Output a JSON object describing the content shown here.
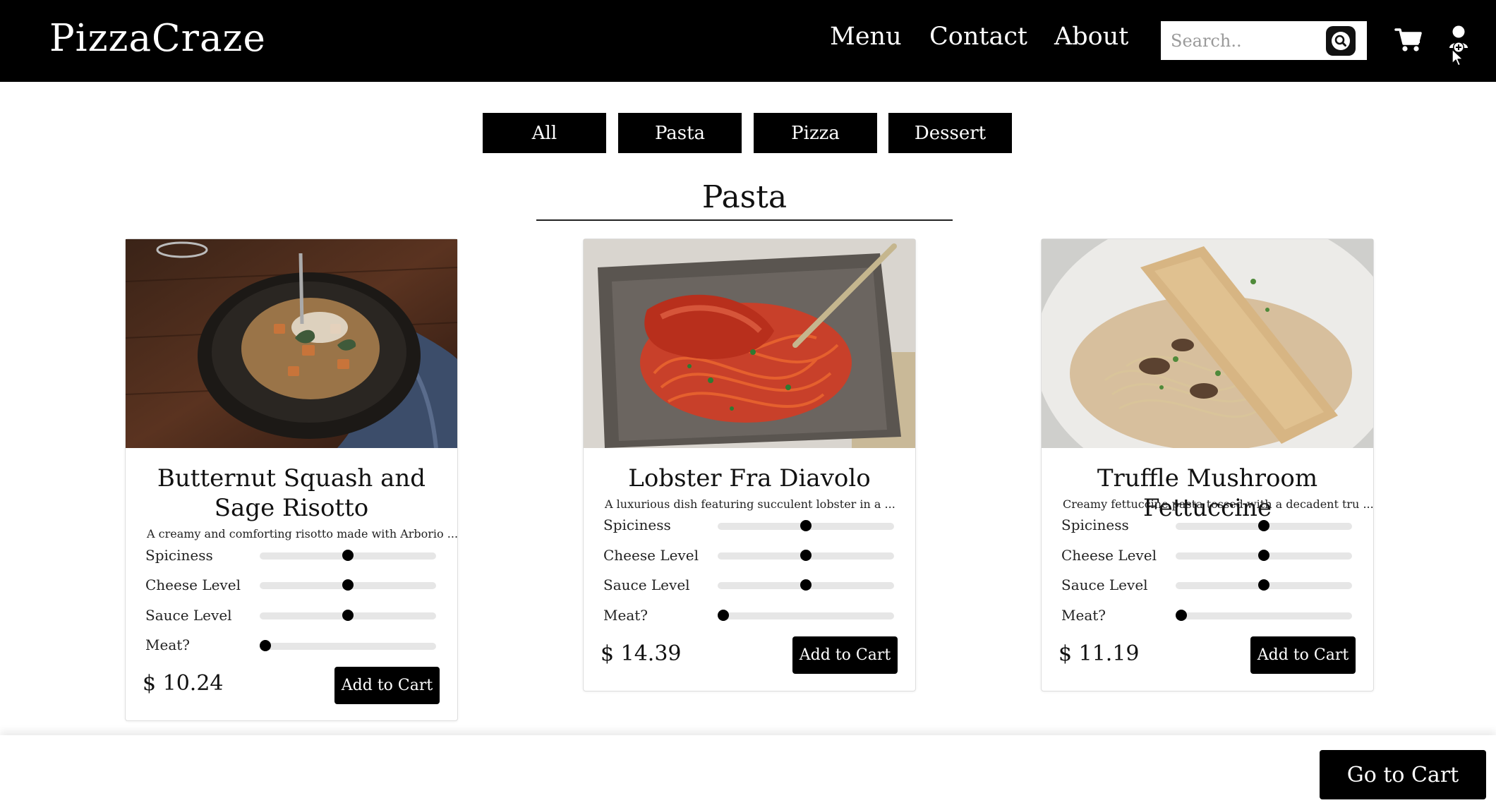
{
  "header": {
    "brand": "PizzaCraze",
    "nav": [
      "Menu",
      "Contact",
      "About"
    ],
    "search_placeholder": "Search..",
    "icons": [
      "search-icon",
      "cart-icon",
      "user-add-icon"
    ]
  },
  "categories": [
    "All",
    "Pasta",
    "Pizza",
    "Dessert"
  ],
  "section_title": "Pasta",
  "slider_labels": [
    "Spiciness",
    "Cheese Level",
    "Sauce Level",
    "Meat?"
  ],
  "cards": [
    {
      "title": "Butternut Squash and Sage Risotto",
      "description": "A creamy and comforting risotto made with Arborio ...",
      "sliders": [
        0.5,
        0.5,
        0.5,
        0.0
      ],
      "price": "$ 10.24",
      "button": "Add to Cart"
    },
    {
      "title": "Lobster Fra Diavolo",
      "description": "A luxurious dish featuring succulent lobster in a ...",
      "sliders": [
        0.5,
        0.5,
        0.5,
        0.0
      ],
      "price": "$ 14.39",
      "button": "Add to Cart"
    },
    {
      "title": "Truffle Mushroom Fettuccine",
      "description": "Creamy fettuccine pasta tossed with a decadent tru ...",
      "sliders": [
        0.5,
        0.5,
        0.5,
        0.0
      ],
      "price": "$ 11.19",
      "button": "Add to Cart"
    }
  ],
  "footer": {
    "go_to_cart": "Go to Cart"
  },
  "colors": {
    "primary": "#000000",
    "background": "#ffffff",
    "track": "#e6e6e6"
  }
}
